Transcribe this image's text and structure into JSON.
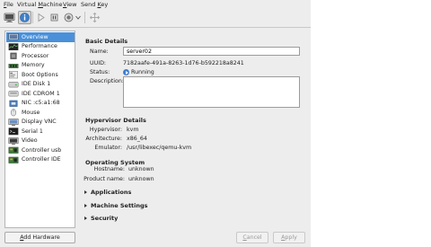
{
  "menubar": {
    "items": [
      "File",
      "Virtual Machine",
      "View",
      "Send Key"
    ],
    "mnemonics": [
      "F",
      "M",
      "V",
      "K"
    ]
  },
  "toolbar": {
    "buttons": [
      "console-icon",
      "details-icon",
      "run-icon",
      "pause-icon",
      "shutdown-icon",
      "fullscreen-icon"
    ]
  },
  "sidebar": {
    "items": [
      {
        "label": "Overview",
        "icon": "overview-icon",
        "selected": true
      },
      {
        "label": "Performance",
        "icon": "performance-icon"
      },
      {
        "label": "Processor",
        "icon": "processor-icon"
      },
      {
        "label": "Memory",
        "icon": "memory-icon"
      },
      {
        "label": "Boot Options",
        "icon": "boot-options-icon"
      },
      {
        "label": "IDE Disk 1",
        "icon": "disk-icon"
      },
      {
        "label": "IDE CDROM 1",
        "icon": "cdrom-icon"
      },
      {
        "label": "NIC :c5:a1:68",
        "icon": "nic-icon"
      },
      {
        "label": "Mouse",
        "icon": "mouse-icon"
      },
      {
        "label": "Display VNC",
        "icon": "display-icon"
      },
      {
        "label": "Serial 1",
        "icon": "serial-icon"
      },
      {
        "label": "Video",
        "icon": "video-icon"
      },
      {
        "label": "Controller usb",
        "icon": "controller-icon"
      },
      {
        "label": "Controller IDE",
        "icon": "controller-icon"
      }
    ]
  },
  "add_hardware": {
    "mnemonic": "A",
    "rest": "dd Hardware"
  },
  "basic": {
    "title": "Basic Details",
    "name_label": "Name:",
    "name_value": "server02",
    "uuid_label": "UUID:",
    "uuid_value": "7182aafe-491a-8263-1d76-b592218a8241",
    "status_label": "Status:",
    "status_value": "Running",
    "description_label": "Description:",
    "description_value": ""
  },
  "hypervisor": {
    "title": "Hypervisor Details",
    "hypervisor_label": "Hypervisor:",
    "hypervisor_value": "kvm",
    "arch_label": "Architecture:",
    "arch_value": "x86_64",
    "emulator_label": "Emulator:",
    "emulator_value": "/usr/libexec/qemu-kvm"
  },
  "os": {
    "title": "Operating System",
    "hostname_label": "Hostname:",
    "hostname_value": "unknown",
    "product_label": "Product name:",
    "product_value": "unknown"
  },
  "expanders": [
    "Applications",
    "Machine Settings",
    "Security"
  ],
  "footer": {
    "cancel_mnemonic": "C",
    "cancel_rest": "ancel",
    "apply_mnemonic": "A",
    "apply_rest": "pply"
  },
  "colors": {
    "selection": "#4a90d9",
    "running": "#3f7fcf"
  }
}
